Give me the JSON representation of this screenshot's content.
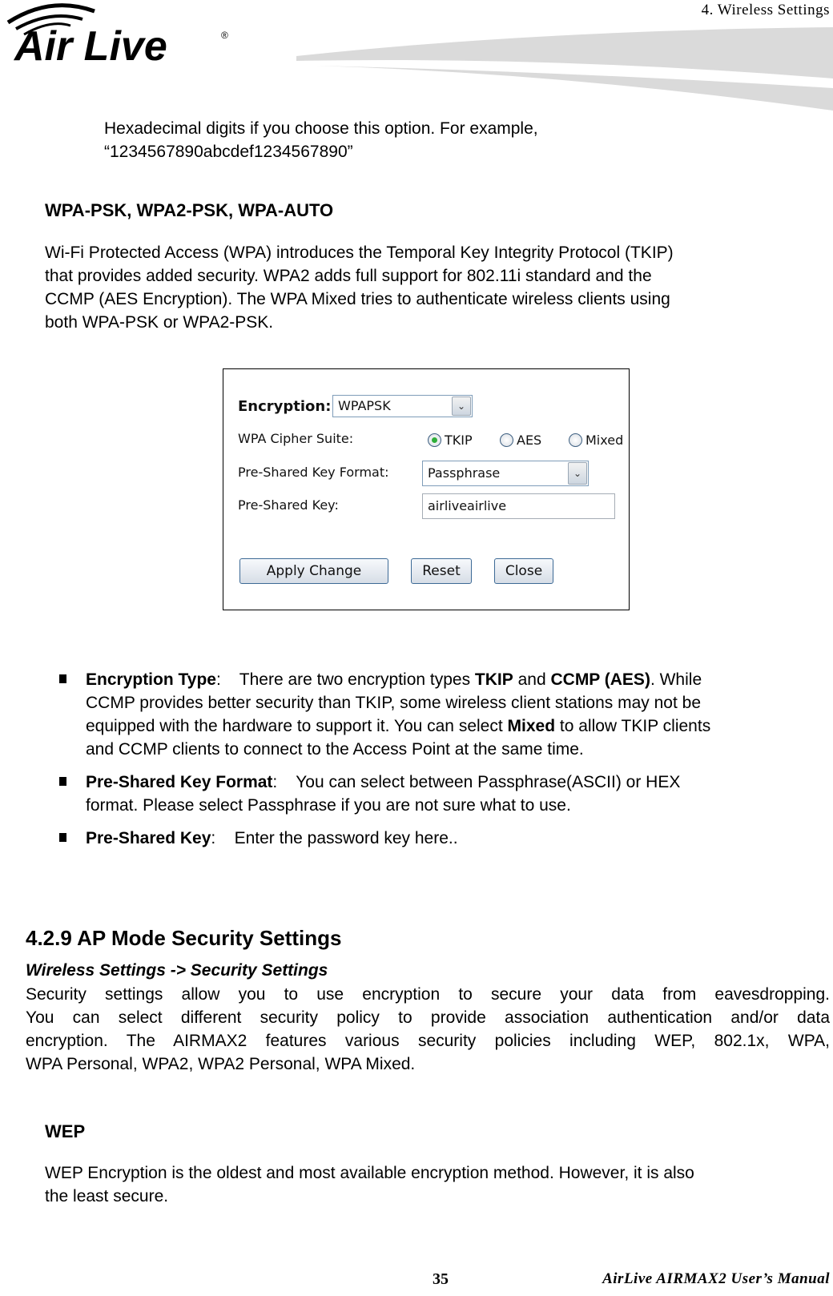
{
  "header": {
    "chapter_title": "4.  Wireless  Settings",
    "logo_text": "Air Live"
  },
  "intro": {
    "line1": "Hexadecimal digits if you choose this option. For example,",
    "line2": "“1234567890abcdef1234567890”"
  },
  "wpa_section": {
    "heading": "WPA-PSK, WPA2-PSK, WPA-AUTO",
    "lines": [
      "Wi-Fi Protected Access (WPA) introduces the Temporal Key Integrity Protocol (TKIP)",
      "that provides added security.    WPA2 adds full support for 802.11i standard and the",
      "CCMP (AES Encryption).    The WPA Mixed tries to authenticate wireless clients using",
      "both WPA-PSK or WPA2-PSK."
    ]
  },
  "screenshot": {
    "encryption_label": "Encryption:",
    "encryption_value": "WPAPSK",
    "cipher_label": "WPA Cipher Suite:",
    "cipher_options": [
      "TKIP",
      "AES",
      "Mixed"
    ],
    "cipher_selected": "TKIP",
    "key_format_label": "Pre-Shared Key Format:",
    "key_format_value": "Passphrase",
    "key_label": "Pre-Shared Key:",
    "key_value": "airliveairlive",
    "buttons": {
      "apply": "Apply Change",
      "reset": "Reset",
      "close": "Close"
    }
  },
  "bullets": [
    {
      "term": "Encryption Type",
      "lines": [
        [
          "There are two encryption types ",
          "TKIP",
          " and ",
          "CCMP (AES)",
          ". While"
        ],
        "CCMP provides better security than TKIP, some wireless client stations may not be",
        [
          "equipped with the hardware to support it. You can select ",
          "Mixed",
          " to allow TKIP clients"
        ],
        "and CCMP clients to connect to the Access Point at the same time."
      ]
    },
    {
      "term": "Pre-Shared Key Format",
      "lines": [
        "You can select between Passphrase(ASCII) or HEX",
        "format.    Please select Passphrase if you are not sure what to use."
      ]
    },
    {
      "term": "Pre-Shared Key",
      "lines": [
        "Enter the password key here.."
      ]
    }
  ],
  "ap_section": {
    "heading": "4.2.9 AP Mode Security Settings",
    "breadcrumb": "Wireless Settings -> Security Settings",
    "lines": [
      "Security settings allow you to use encryption to secure your data from eavesdropping.",
      "You can select different security policy to provide association authentication and/or data",
      "encryption.    The AIRMAX2 features various security policies including WEP, 802.1x, WPA,",
      "WPA Personal, WPA2, WPA2 Personal, WPA Mixed."
    ]
  },
  "wep_section": {
    "heading": "WEP",
    "lines": [
      "WEP Encryption is the oldest and most available encryption method.    However, it is also",
      "the least secure."
    ]
  },
  "footer": {
    "page_number": "35",
    "manual_title": "AirLive  AIRMAX2  User’s  Manual"
  }
}
